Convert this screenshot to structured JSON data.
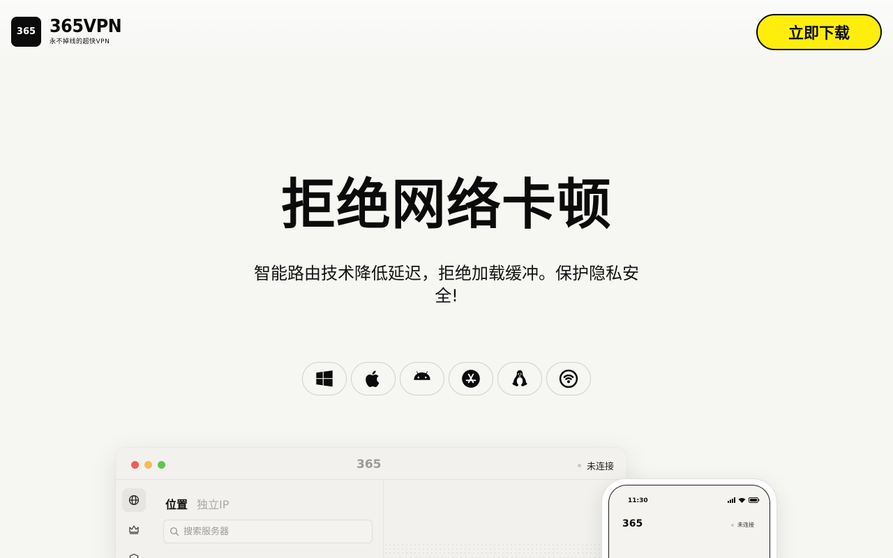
{
  "brand": {
    "mark": "365",
    "name": "365VPN",
    "slogan": "永不掉线的超快VPN"
  },
  "header": {
    "download_label": "立即下载"
  },
  "hero": {
    "title": "拒绝网络卡顿",
    "subtitle": "智能路由技术降低延迟，拒绝加载缓冲。保护隐私安全!"
  },
  "platforms": [
    {
      "icon": "windows-icon"
    },
    {
      "icon": "apple-icon"
    },
    {
      "icon": "android-icon"
    },
    {
      "icon": "app-store-icon"
    },
    {
      "icon": "linux-icon"
    },
    {
      "icon": "router-icon"
    }
  ],
  "desktop_app": {
    "logo": "365",
    "status": "未连接",
    "tabs": [
      "位置",
      "独立IP"
    ],
    "search_placeholder": "搜索服务器"
  },
  "phone_app": {
    "time": "11:30",
    "logo": "365",
    "status": "未连接"
  },
  "colors": {
    "accent": "#ffee0c",
    "background": "#f6f6f3",
    "text": "#0b0b0b"
  }
}
